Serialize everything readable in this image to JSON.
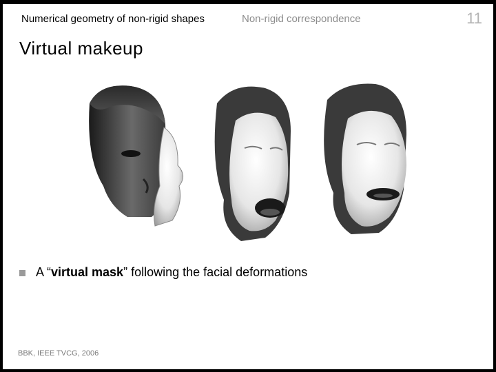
{
  "header": {
    "course": "Numerical geometry of non-rigid shapes",
    "topic": "Non-rigid correspondence",
    "page_number": "11"
  },
  "slide": {
    "title": "Virtual makeup",
    "bullet": {
      "prefix": "A “",
      "bold": "virtual mask",
      "suffix": "” following the facial deformations"
    },
    "citation": "BBK, IEEE TVCG, 2006"
  },
  "figure": {
    "icon": "face-scan-sequence-image"
  }
}
